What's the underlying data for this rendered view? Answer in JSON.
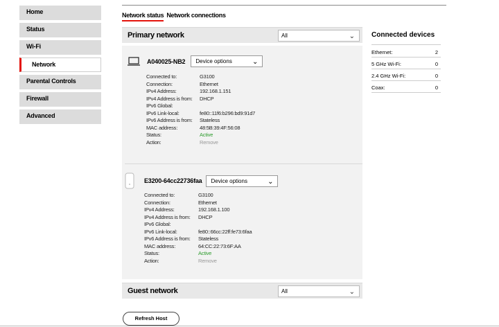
{
  "sidebar": {
    "items": [
      {
        "label": "Home"
      },
      {
        "label": "Status"
      },
      {
        "label": "Wi-Fi"
      },
      {
        "label": "Network"
      },
      {
        "label": "Parental Controls"
      },
      {
        "label": "Firewall"
      },
      {
        "label": "Advanced"
      }
    ],
    "active": "Network"
  },
  "tabs": [
    {
      "label": "Network status"
    },
    {
      "label": "Network connections"
    }
  ],
  "primary": {
    "title": "Primary network",
    "filter": "All"
  },
  "guest": {
    "title": "Guest network",
    "filter": "All"
  },
  "devices": [
    {
      "name": "A040025-NB2",
      "options_label": "Device options",
      "icon": "laptop-icon",
      "props": [
        {
          "k": "Connected to:",
          "v": "G3100"
        },
        {
          "k": "Connection:",
          "v": "Ethernet"
        },
        {
          "k": "IPv4 Address:",
          "v": "192.168.1.151"
        },
        {
          "k": "IPv4 Address is from:",
          "v": "DHCP"
        },
        {
          "k": "IPv6 Global:",
          "v": ""
        },
        {
          "k": "IPv6 Link-local:",
          "v": "fe80::11f6:b296:bd9:91d7"
        },
        {
          "k": "IPv6 Address is from:",
          "v": "Stateless"
        },
        {
          "k": "MAC address:",
          "v": "48:5B:39:4F:56:08"
        },
        {
          "k": "Status:",
          "v": "Active"
        },
        {
          "k": "Action:",
          "v": "Remove"
        }
      ]
    },
    {
      "name": "E3200-64cc22736faa",
      "options_label": "Device options",
      "icon": "extender-icon",
      "props": [
        {
          "k": "Connected to:",
          "v": "G3100"
        },
        {
          "k": "Connection:",
          "v": "Ethernet"
        },
        {
          "k": "IPv4 Address:",
          "v": "192.168.1.100"
        },
        {
          "k": "IPv4 Address is from:",
          "v": "DHCP"
        },
        {
          "k": "IPv6 Global:",
          "v": ""
        },
        {
          "k": "IPv6 Link-local:",
          "v": "fe80::66cc:22ff:fe73:6faa"
        },
        {
          "k": "IPv6 Address is from:",
          "v": "Stateless"
        },
        {
          "k": "MAC address:",
          "v": "64:CC:22:73:6F:AA"
        },
        {
          "k": "Status:",
          "v": "Active"
        },
        {
          "k": "Action:",
          "v": "Remove"
        }
      ]
    }
  ],
  "connected_devices": {
    "title": "Connected devices",
    "rows": [
      {
        "label": "Ethernet:",
        "count": "2"
      },
      {
        "label": "5 GHz Wi-Fi:",
        "count": "0"
      },
      {
        "label": "2.4 GHz Wi-Fi:",
        "count": "0"
      },
      {
        "label": "Coax:",
        "count": "0"
      }
    ]
  },
  "refresh_label": "Refresh Host",
  "colors": {
    "accent": "#e3120b",
    "active_status": "#2e9c2e",
    "muted": "#999999",
    "panel": "#f2f2f2"
  }
}
